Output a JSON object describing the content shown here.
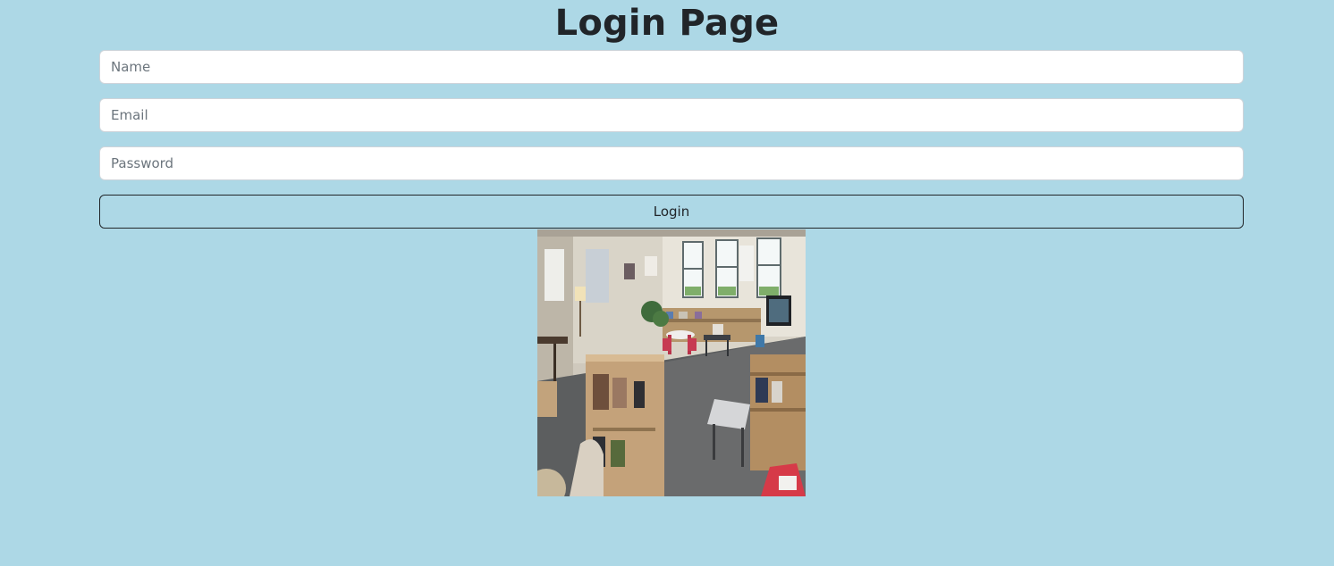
{
  "page": {
    "title": "Login Page",
    "background_color": "#add8e6"
  },
  "form": {
    "name_placeholder": "Name",
    "name_value": "",
    "email_placeholder": "Email",
    "email_value": "",
    "password_placeholder": "Password",
    "password_value": "",
    "login_label": "Login"
  },
  "image": {
    "subject": "classroom-photo"
  }
}
